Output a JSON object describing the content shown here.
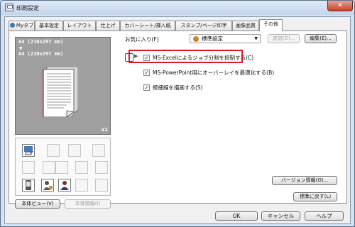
{
  "window": {
    "title": "印刷設定",
    "close_symbol": "✕"
  },
  "tabs": [
    {
      "label": "Myタブ"
    },
    {
      "label": "基本設定"
    },
    {
      "label": "レイアウト"
    },
    {
      "label": "仕上げ"
    },
    {
      "label": "カバーシート/挿入紙"
    },
    {
      "label": "スタンプ/ページ印字"
    },
    {
      "label": "画像品質"
    },
    {
      "label": "その他"
    }
  ],
  "preview": {
    "paper_line1": "A4 (210x297 mm)",
    "arrow": "▼",
    "paper_line2": "A4 (210x297 mm)",
    "copies": "x1"
  },
  "left_buttons": {
    "printer_view": "本体ビュー(V)",
    "printer_info": "本体情報(I)"
  },
  "favorites": {
    "label": "お気に入り(F)",
    "selected": "標準設定",
    "add_button": "追加(D)...",
    "edit_button": "編集(E)..."
  },
  "options": [
    {
      "label": "MS-Excelによるジョブ分割を抑制する(C)",
      "checked": true,
      "highlighted": true
    },
    {
      "label": "MS-PowerPoint用にオーバーレイを最適化する(B)",
      "checked": true
    },
    {
      "label": "極細線を描画する(S)",
      "checked": true
    }
  ],
  "check_mark": "✓",
  "info_icon_glyph": "i",
  "version_button": "バージョン情報(O)...",
  "restore_defaults_button": "標準に戻す(L)",
  "footer": {
    "ok": "OK",
    "cancel": "キャンセル",
    "help": "ヘルプ"
  }
}
